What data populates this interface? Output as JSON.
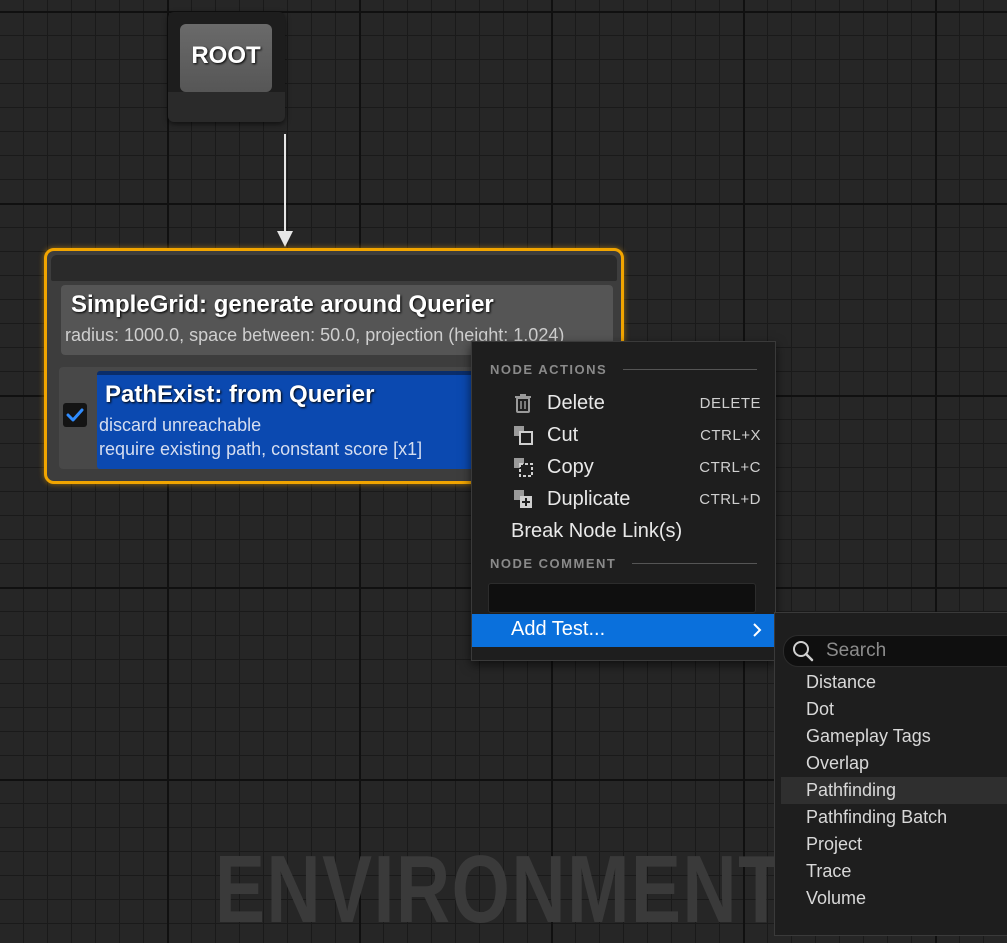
{
  "watermark": "ENVIRONMENT",
  "root_node": {
    "label": "ROOT"
  },
  "generator_node": {
    "title": "SimpleGrid: generate around Querier",
    "description": "radius: 1000.0, space between: 50.0, projection (height: 1,024)"
  },
  "test_node": {
    "title": "PathExist: from Querier",
    "line1": "discard unreachable",
    "line2": "require existing path, constant score [x1]",
    "enabled": true
  },
  "context_menu": {
    "node_actions_header": "NODE ACTIONS",
    "items": [
      {
        "label": "Delete",
        "shortcut": "DELETE",
        "icon": "trash-icon"
      },
      {
        "label": "Cut",
        "shortcut": "CTRL+X",
        "icon": "cut-icon"
      },
      {
        "label": "Copy",
        "shortcut": "CTRL+C",
        "icon": "copy-icon"
      },
      {
        "label": "Duplicate",
        "shortcut": "CTRL+D",
        "icon": "duplicate-icon"
      },
      {
        "label": "Break Node Link(s)",
        "shortcut": "",
        "icon": ""
      }
    ],
    "node_comment_header": "NODE COMMENT",
    "comment_value": "",
    "add_test_label": "Add Test..."
  },
  "submenu": {
    "search_placeholder": "Search",
    "items": [
      "Distance",
      "Dot",
      "Gameplay Tags",
      "Overlap",
      "Pathfinding",
      "Pathfinding Batch",
      "Project",
      "Trace",
      "Volume"
    ],
    "hovered": "Pathfinding"
  },
  "colors": {
    "selection_outline": "#f2a500",
    "test_card": "#0b49b0",
    "menu_highlight": "#0a70dc",
    "grid_bg": "#262626"
  }
}
